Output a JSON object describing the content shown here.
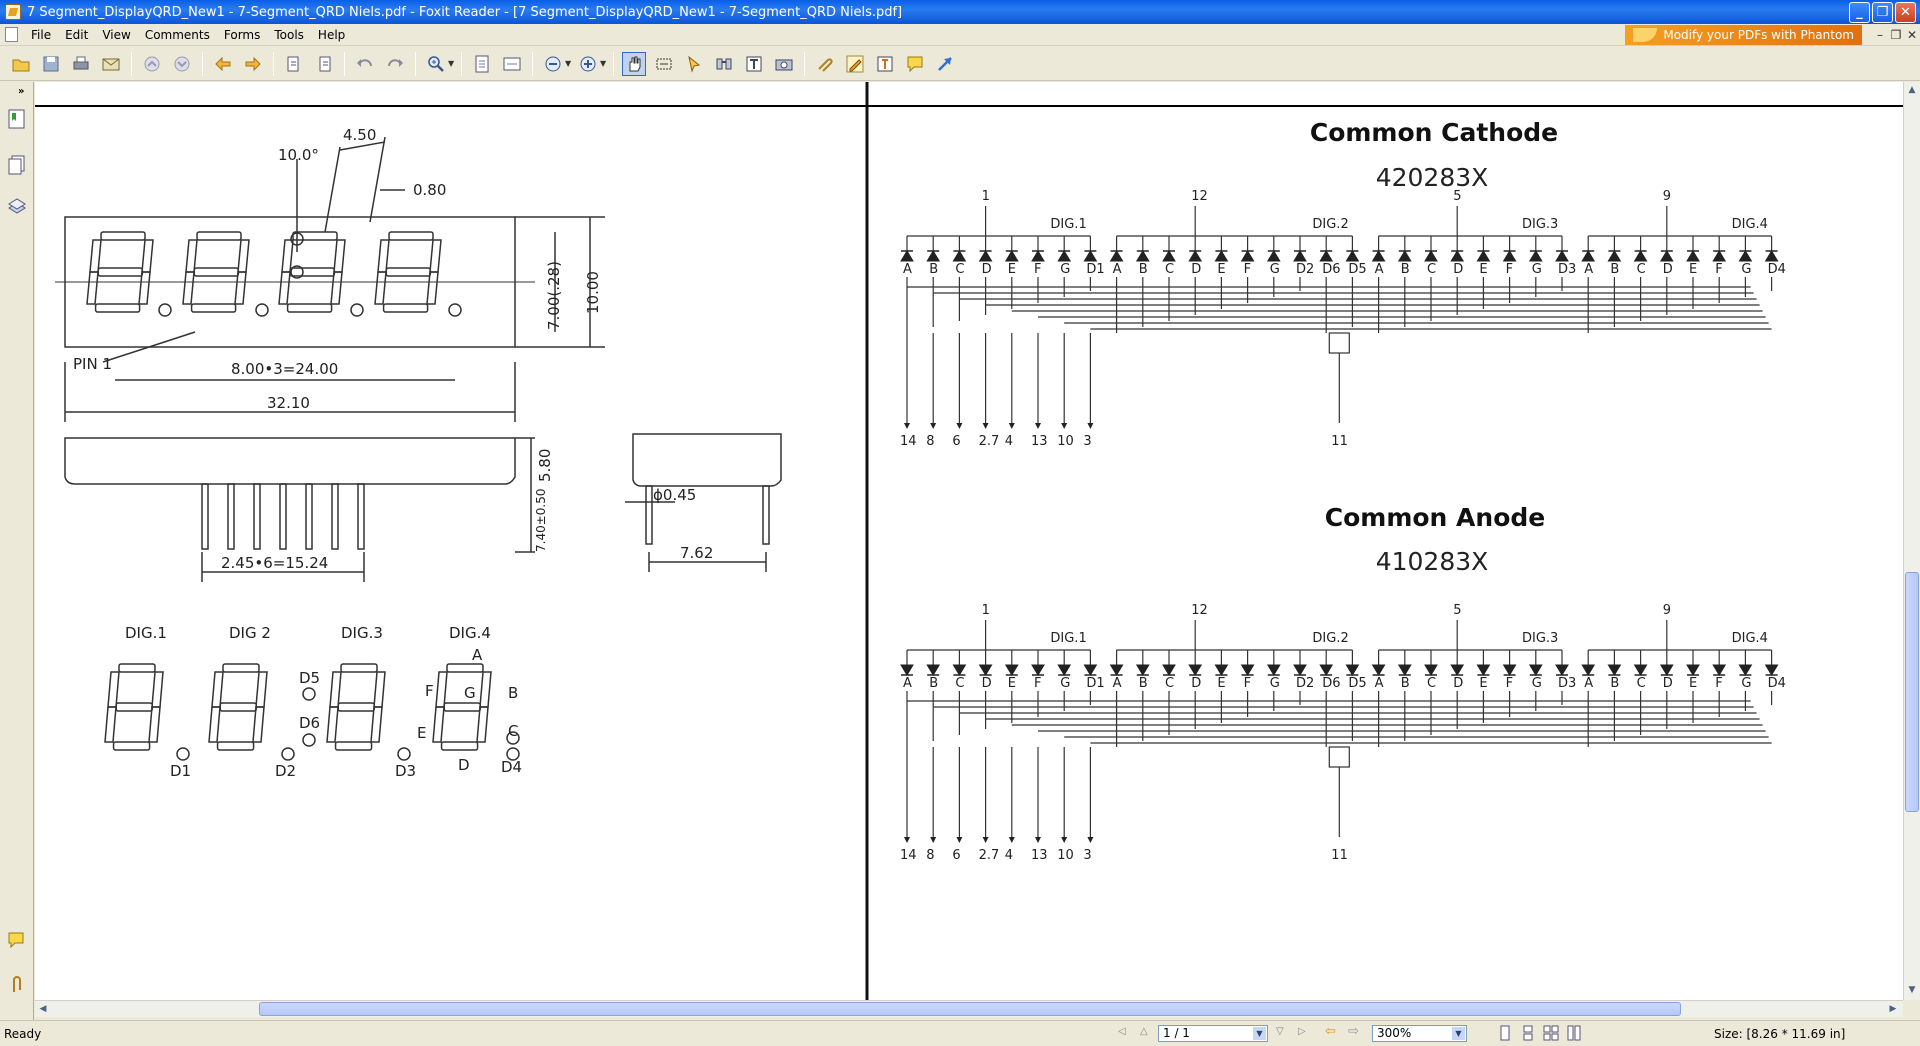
{
  "window": {
    "title": "7 Segment_DisplayQRD_New1 - 7-Segment_QRD Niels.pdf - Foxit Reader - [7 Segment_DisplayQRD_New1 - 7-Segment_QRD Niels.pdf]",
    "minimize": "_",
    "restore": "❐",
    "close": "✕"
  },
  "menu": {
    "items": [
      "File",
      "Edit",
      "View",
      "Comments",
      "Forms",
      "Tools",
      "Help"
    ],
    "promo": "Modify your PDFs with Phantom",
    "doc_min": "–",
    "doc_restore": "❐",
    "doc_close": "✕"
  },
  "document": {
    "left_page": {
      "dims": {
        "d_4_50": "4.50",
        "d_10deg": "10.0°",
        "d_0_80": "0.80",
        "d_7_00": "7.00(.28)",
        "d_10_00": "10.00",
        "pin1": "PIN 1",
        "d_8x3": "8.00•3=24.00",
        "d_32_10": "32.10",
        "d_5_80": "5.80",
        "d_7_40": "7.40±0.50",
        "d_phi": "ɸ0.45",
        "d_7_62": "7.62",
        "d_2_45": "2.45•6=15.24"
      },
      "digit_labels": [
        "DIG.1",
        "DIG 2",
        "DIG.3",
        "DIG.4"
      ],
      "seg_labels": {
        "A": "A",
        "B": "B",
        "C": "C",
        "D": "D",
        "E": "E",
        "F": "F",
        "G": "G",
        "D1": "D1",
        "D2": "D2",
        "D3": "D3",
        "D4": "D4",
        "D5": "D5",
        "D6": "D6"
      }
    },
    "right_page": {
      "cathode_title": "Common Cathode",
      "cathode_part": "420283X",
      "anode_title": "Common Anode",
      "anode_part": "410283X",
      "dig_labels": [
        "DIG.1",
        "DIG.2",
        "DIG.3",
        "DIG.4"
      ],
      "common_pins": [
        "1",
        "12",
        "5",
        "9"
      ],
      "seg_groups": [
        [
          "A",
          "B",
          "C",
          "D",
          "E",
          "F",
          "G",
          "D1"
        ],
        [
          "A",
          "B",
          "C",
          "D",
          "E",
          "F",
          "G",
          "D2",
          "D6",
          "D5"
        ],
        [
          "A",
          "B",
          "C",
          "D",
          "E",
          "F",
          "G",
          "D3"
        ],
        [
          "A",
          "B",
          "C",
          "D",
          "E",
          "F",
          "G",
          "D4"
        ]
      ],
      "bottom_pins": [
        "14",
        "8",
        "6",
        "2.7",
        "4",
        "13",
        "10",
        "3"
      ],
      "dp_pin": "11"
    }
  },
  "status": {
    "ready": "Ready",
    "page": "1 / 1",
    "zoom": "300%",
    "size": "Size: [8.26 * 11.69 in]"
  }
}
